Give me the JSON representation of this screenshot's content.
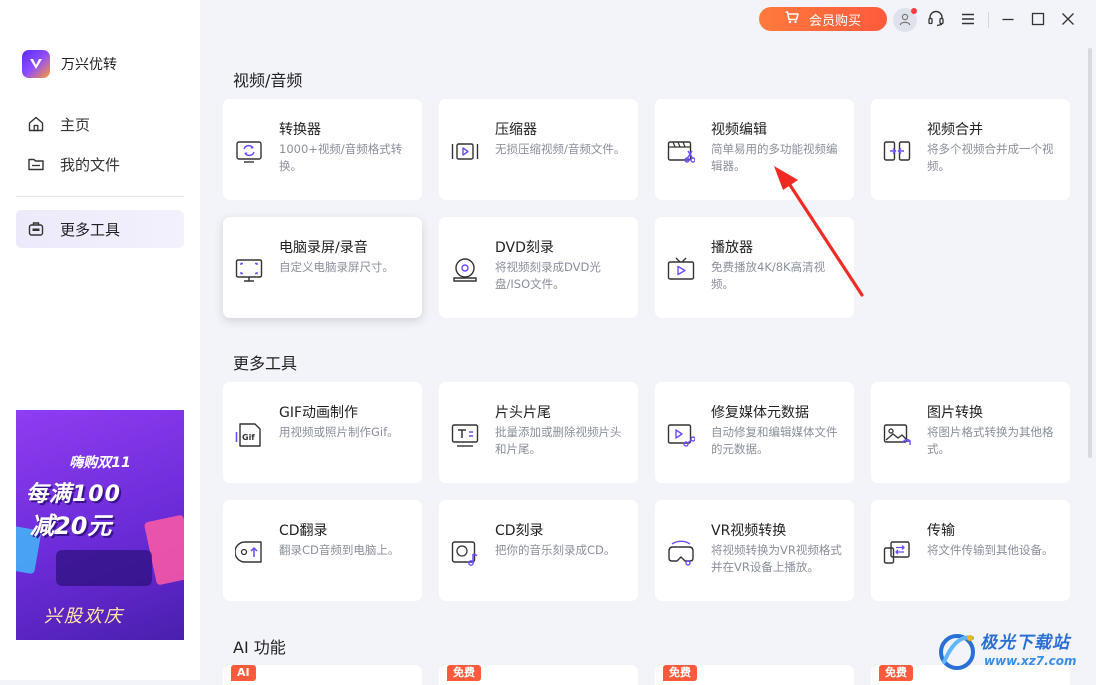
{
  "app": {
    "name": "万兴优转"
  },
  "sidebar": {
    "items": [
      {
        "id": "home",
        "label": "主页",
        "icon": "home-icon"
      },
      {
        "id": "files",
        "label": "我的文件",
        "icon": "folder-icon"
      },
      {
        "id": "tools",
        "label": "更多工具",
        "icon": "toolbox-icon",
        "active": true
      }
    ],
    "promo": {
      "line1": "嗨购双11",
      "line2": "每满100",
      "line3": "减20元",
      "line4": "兴股欢庆"
    }
  },
  "titlebar": {
    "vip_label": "会员购买",
    "accent": "#ff6a3c"
  },
  "sections": [
    {
      "title": "视频/音频",
      "cards": [
        {
          "title": "转换器",
          "desc": "1000+视频/音频格式转换。",
          "icon": "convert-icon"
        },
        {
          "title": "压缩器",
          "desc": "无损压缩视频/音频文件。",
          "icon": "compress-icon"
        },
        {
          "title": "视频编辑",
          "desc": "简单易用的多功能视频编辑器。",
          "icon": "video-edit-icon"
        },
        {
          "title": "视频合并",
          "desc": "将多个视频合并成一个视频。",
          "icon": "merge-icon"
        },
        {
          "title": "电脑录屏/录音",
          "desc": "自定义电脑录屏尺寸。",
          "icon": "screen-record-icon"
        },
        {
          "title": "DVD刻录",
          "desc": "将视频刻录成DVD光盘/ISO文件。",
          "icon": "dvd-icon"
        },
        {
          "title": "播放器",
          "desc": "免费播放4K/8K高清视频。",
          "icon": "player-icon"
        }
      ]
    },
    {
      "title": "更多工具",
      "cards": [
        {
          "title": "GIF动画制作",
          "desc": "用视频或照片制作Gif。",
          "icon": "gif-icon"
        },
        {
          "title": "片头片尾",
          "desc": "批量添加或删除视频片头和片尾。",
          "icon": "intro-outro-icon"
        },
        {
          "title": "修复媒体元数据",
          "desc": "自动修复和编辑媒体文件的元数据。",
          "icon": "metadata-icon"
        },
        {
          "title": "图片转换",
          "desc": "将图片格式转换为其他格式。",
          "icon": "image-convert-icon"
        },
        {
          "title": "CD翻录",
          "desc": "翻录CD音频到电脑上。",
          "icon": "cd-rip-icon"
        },
        {
          "title": "CD刻录",
          "desc": "把你的音乐刻录成CD。",
          "icon": "cd-burn-icon"
        },
        {
          "title": "VR视频转换",
          "desc": "将视频转换为VR视频格式并在VR设备上播放。",
          "icon": "vr-icon"
        },
        {
          "title": "传输",
          "desc": "将文件传输到其他设备。",
          "icon": "transfer-icon"
        }
      ]
    },
    {
      "title": "AI 功能",
      "badges": [
        "AI",
        "免费",
        "免费",
        "免费"
      ]
    }
  ],
  "watermark": {
    "line1": "极光下载站",
    "line2": "www.xz7.com"
  }
}
